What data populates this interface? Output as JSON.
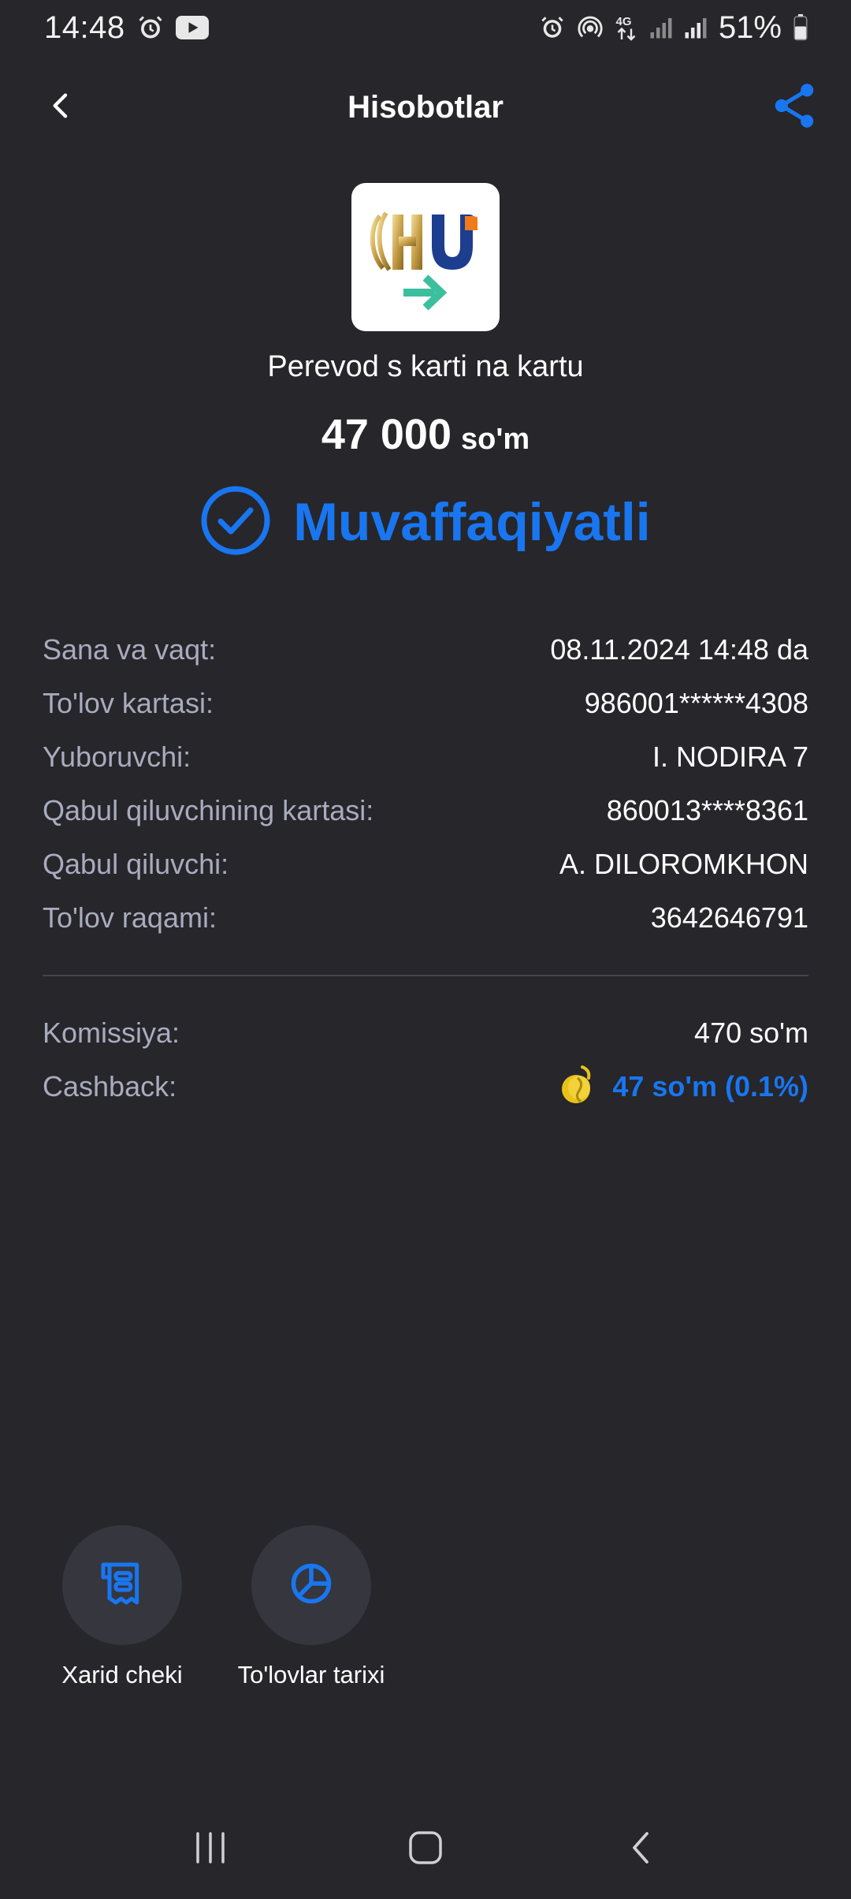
{
  "status_bar": {
    "time": "14:48",
    "battery": "51%",
    "icons": [
      "alarm-icon",
      "youtube-icon",
      "alarm-icon",
      "hotspot-icon",
      "4g-icon",
      "signal-icon",
      "signal-icon",
      "battery-icon"
    ]
  },
  "header": {
    "title": "Hisobotlar",
    "back_icon": "chevron-left-icon",
    "share_icon": "share-icon"
  },
  "merchant": {
    "logo_text": "HU",
    "title": "Perevod s karti na kartu"
  },
  "amount": {
    "value": "47 000",
    "currency": "so'm"
  },
  "status": {
    "text": "Muvaffaqiyatli",
    "icon": "check-circle-icon"
  },
  "details": [
    {
      "label": "Sana va vaqt:",
      "value": "08.11.2024 14:48 da"
    },
    {
      "label": "To'lov kartasi:",
      "value": "986001******4308"
    },
    {
      "label": "Yuboruvchi:",
      "value": "I. NODIRA 7"
    },
    {
      "label": "Qabul qiluvchining kartasi:",
      "value": "860013****8361"
    },
    {
      "label": "Qabul qiluvchi:",
      "value": "A. DILOROMKHON"
    },
    {
      "label": "To'lov raqami:",
      "value": "3642646791"
    }
  ],
  "fees": {
    "commission_label": "Komissiya:",
    "commission_value": "470 so'm",
    "cashback_label": "Cashback:",
    "cashback_value": "47 so'm (0.1%)"
  },
  "actions": [
    {
      "label": "Xarid cheki",
      "icon": "receipt-icon"
    },
    {
      "label": "To'lovlar tarixi",
      "icon": "pie-chart-icon"
    }
  ],
  "colors": {
    "background": "#26262b",
    "accent": "#1976f0",
    "label": "#a9abbe",
    "cashback_coin": "#e8c21a"
  }
}
